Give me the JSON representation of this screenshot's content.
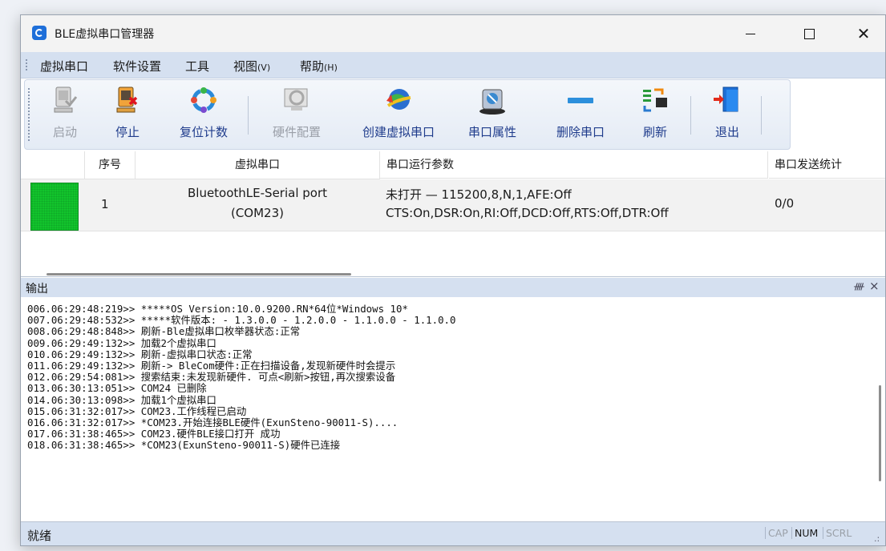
{
  "window": {
    "title": "BLE虚拟串口管理器"
  },
  "menu": [
    {
      "label": "虚拟串口",
      "shortcut": ""
    },
    {
      "label": "软件设置",
      "shortcut": ""
    },
    {
      "label": "工具",
      "shortcut": ""
    },
    {
      "label": "视图",
      "shortcut": "(V)"
    },
    {
      "label": "帮助",
      "shortcut": "(H)"
    }
  ],
  "toolbar": {
    "start": "启动",
    "stop": "停止",
    "reset_count": "复位计数",
    "hw_config": "硬件配置",
    "create_port": "创建虚拟串口",
    "port_props": "串口属性",
    "delete_port": "删除串口",
    "refresh": "刷新",
    "exit": "退出"
  },
  "table": {
    "headers": {
      "index": "序号",
      "port": "虚拟串口",
      "params": "串口运行参数",
      "stats": "串口发送统计"
    },
    "rows": [
      {
        "status_color": "#12c42c",
        "index": "1",
        "port_name": "BluetoothLE-Serial port",
        "port_com": "(COM23)",
        "params_line1": "未打开 — 115200,8,N,1,AFE:Off",
        "params_line2": "CTS:On,DSR:On,RI:Off,DCD:Off,RTS:Off,DTR:Off",
        "stats": "0/0"
      }
    ]
  },
  "output": {
    "title": "输出",
    "pin": "ᚎ",
    "close": "×",
    "lines": [
      "006.06:29:48:219>> *****OS Version:10.0.9200.RN*64位*Windows 10*",
      "007.06:29:48:532>> *****软件版本: - 1.3.0.0 - 1.2.0.0 - 1.1.0.0 - 1.1.0.0",
      "008.06:29:48:848>> 刷新-Ble虚拟串口枚举器状态:正常",
      "009.06:29:49:132>> 加载2个虚拟串口",
      "010.06:29:49:132>> 刷新-虚拟串口状态:正常",
      "011.06:29:49:132>> 刷新-> BleCom硬件:正在扫描设备,发现新硬件时会提示",
      "012.06:29:54:081>> 搜索结束:未发现新硬件. 可点<刷新>按钮,再次搜索设备",
      "013.06:30:13:051>> COM24 已删除",
      "014.06:30:13:098>> 加载1个虚拟串口",
      "015.06:31:32:017>> COM23.工作线程已启动",
      "016.06:31:32:017>> *COM23.开始连接BLE硬件(ExunSteno-90011-S)....",
      "017.06:31:38:465>> COM23.硬件BLE接口打开 成功",
      "018.06:31:38:465>> *COM23(ExunSteno-90011-S)硬件已连接"
    ]
  },
  "status": {
    "text": "就绪",
    "cap": "CAP",
    "num": "NUM",
    "scrl": "SCRL"
  }
}
